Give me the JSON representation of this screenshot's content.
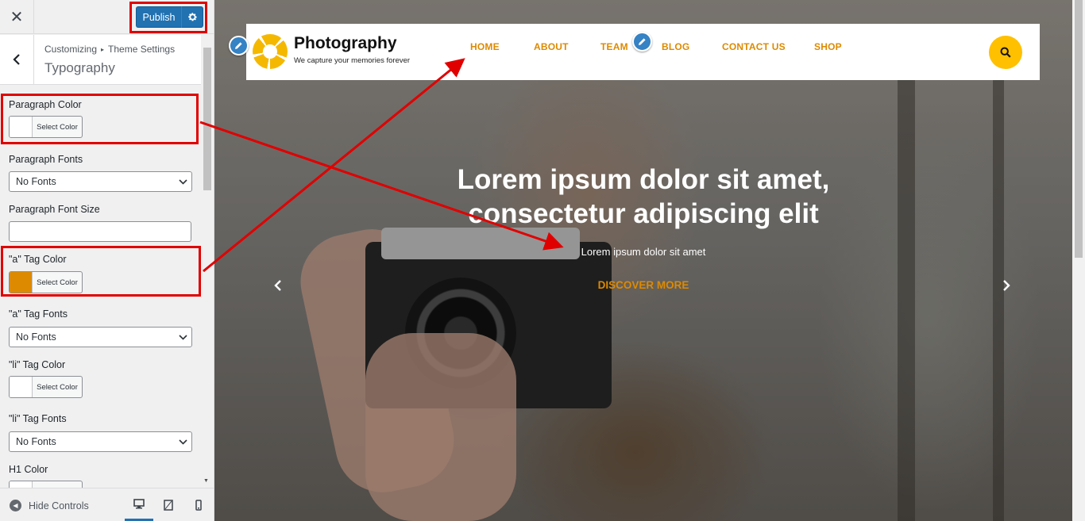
{
  "customizer": {
    "publish_label": "Publish",
    "breadcrumb": [
      "Customizing",
      "Theme Settings"
    ],
    "breadcrumb_sep": "▸",
    "section_title": "Typography",
    "close_symbol": "✕",
    "controls": {
      "paragraph_color_label": "Paragraph Color",
      "paragraph_fonts_label": "Paragraph Fonts",
      "paragraph_font_size_label": "Paragraph Font Size",
      "a_color_label": "\"a\" Tag Color",
      "a_fonts_label": "\"a\" Tag Fonts",
      "li_color_label": "\"li\" Tag Color",
      "li_fonts_label": "\"li\" Tag Fonts",
      "h1_color_label": "H1 Color",
      "select_color_text": "Select Color",
      "no_fonts": "No Fonts",
      "paragraph_font_size_value": "",
      "paragraph_color_value": "#ffffff",
      "a_color_value": "#dd8a00",
      "li_color_value": "#ffffff"
    },
    "footer": {
      "hide_controls_label": "Hide Controls",
      "devices": [
        "desktop-icon",
        "tablet-icon",
        "mobile-icon"
      ],
      "active_device": "desktop"
    }
  },
  "site": {
    "logo_title": "Photography",
    "logo_tagline": "We capture your memories forever",
    "nav": [
      "HOME",
      "ABOUT",
      "TEAM",
      "BLOG",
      "CONTACT US",
      "SHOP"
    ],
    "hero_title_line1": "Lorem ipsum dolor sit amet,",
    "hero_title_line2": "consectetur adipiscing elit",
    "hero_subtitle": "Lorem ipsum dolor sit amet",
    "cta": "DISCOVER MORE",
    "prev_symbol": "‹",
    "next_symbol": "›"
  },
  "colors": {
    "accent_orange": "#dd8a00",
    "publish_blue": "#2271b1",
    "search_yellow": "#ffc000",
    "annotation_red": "#e00000"
  }
}
